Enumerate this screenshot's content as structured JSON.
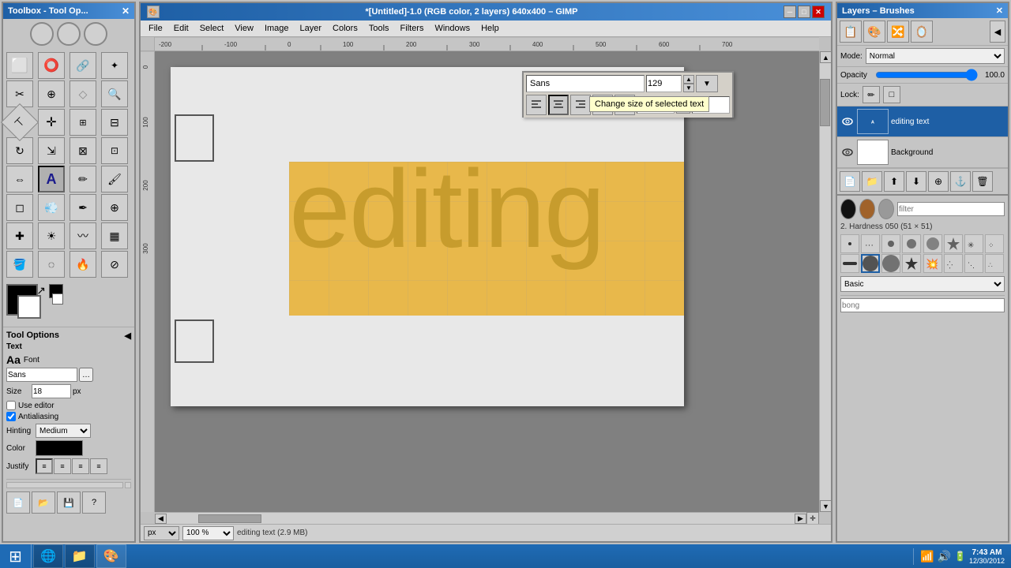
{
  "toolbox": {
    "title": "Toolbox - Tool Op...",
    "tools": [
      {
        "name": "rectangle-select",
        "icon": "□",
        "active": false
      },
      {
        "name": "ellipse-select",
        "icon": "○",
        "active": false
      },
      {
        "name": "free-select",
        "icon": "⌖",
        "active": false
      },
      {
        "name": "fuzzy-select",
        "icon": "✦",
        "active": false
      },
      {
        "name": "crop",
        "icon": "⊕",
        "active": false
      },
      {
        "name": "transform",
        "icon": "↔",
        "active": false
      },
      {
        "name": "flip",
        "icon": "⇔",
        "active": false
      },
      {
        "name": "text",
        "icon": "A",
        "active": true
      },
      {
        "name": "color-picker",
        "icon": "◈",
        "active": false
      },
      {
        "name": "magnify",
        "icon": "🔍",
        "active": false
      },
      {
        "name": "measure",
        "icon": "⊢",
        "active": false
      },
      {
        "name": "move",
        "icon": "✛",
        "active": false
      },
      {
        "name": "pencil",
        "icon": "✏",
        "active": false
      },
      {
        "name": "paint",
        "icon": "▲",
        "active": false
      },
      {
        "name": "eraser",
        "icon": "◻",
        "active": false
      },
      {
        "name": "airbrush",
        "icon": "∿",
        "active": false
      },
      {
        "name": "clone",
        "icon": "⊕",
        "active": false
      },
      {
        "name": "heal",
        "icon": "✚",
        "active": false
      },
      {
        "name": "perspective",
        "icon": "⌖",
        "active": false
      },
      {
        "name": "blend",
        "icon": "▦",
        "active": false
      },
      {
        "name": "bucket",
        "icon": "⬡",
        "active": false
      },
      {
        "name": "ink",
        "icon": "◈",
        "active": false
      },
      {
        "name": "dodge-burn",
        "icon": "☻",
        "active": false
      },
      {
        "name": "smudge",
        "icon": "⌀",
        "active": false
      }
    ],
    "options": {
      "title": "Tool Options",
      "text_label": "Text",
      "font_label": "Font",
      "font_value": "Sans",
      "size_label": "Size",
      "size_value": "18",
      "size_unit": "px",
      "use_editor_label": "Use editor",
      "antialiasing_label": "Antialiasing",
      "hinting_label": "Hinting",
      "hinting_value": "Medium",
      "color_label": "Color",
      "justify_label": "Justify"
    }
  },
  "gimp_window": {
    "title": "*[Untitled]-1.0 (RGB color, 2 layers) 640x400 – GIMP",
    "menus": [
      "File",
      "Edit",
      "Select",
      "View",
      "Image",
      "Layer",
      "Colors",
      "Tools",
      "Filters",
      "Windows",
      "Help"
    ],
    "canvas": {
      "text": "editing",
      "font": "Sans",
      "font_size": "129",
      "x_val": "0.0",
      "y_val": "0.0"
    },
    "tooltip": "Change size of selected text",
    "status": {
      "unit": "px",
      "zoom": "100 %",
      "layer": "editing text (2.9 MB)"
    }
  },
  "layers_panel": {
    "title": "Layers – Brushes",
    "mode_label": "Mode:",
    "mode_value": "Normal",
    "opacity_label": "Opacity",
    "opacity_value": "100.0",
    "lock_label": "Lock:",
    "layers": [
      {
        "name": "editing text",
        "visible": true,
        "active": true
      },
      {
        "name": "Background",
        "visible": true,
        "active": false
      }
    ],
    "brushes": {
      "filter_placeholder": "filter",
      "info": "2. Hardness 050 (51 × 51)",
      "category": "Basic",
      "swatches": [
        "black-circle",
        "brown-circle",
        "gray-circle"
      ],
      "items": [
        {
          "name": "dot-small",
          "shape": "dot",
          "size": 8
        },
        {
          "name": "brush-scattered",
          "shape": "scattered",
          "size": 10
        },
        {
          "name": "brush-fuzzy-sm",
          "shape": "fuzzy-sm",
          "size": 14
        },
        {
          "name": "brush-fuzzy-md",
          "shape": "fuzzy-md",
          "size": 20
        },
        {
          "name": "brush-fuzzy-lg",
          "shape": "fuzzy-lg",
          "size": 28
        },
        {
          "name": "brush-star",
          "shape": "star",
          "size": 24
        },
        {
          "name": "brush-splat",
          "shape": "splat",
          "size": 16
        },
        {
          "name": "brush-scattered2",
          "shape": "scattered2",
          "size": 12
        },
        {
          "name": "brush-line",
          "shape": "line",
          "size": 10
        },
        {
          "name": "brush-selected",
          "shape": "circle-lg",
          "size": 34
        },
        {
          "name": "brush-lg-circle",
          "shape": "lg-circle",
          "size": 40
        },
        {
          "name": "brush-star2",
          "shape": "star2",
          "size": 28
        },
        {
          "name": "brush-splatter",
          "shape": "splatter",
          "size": 18
        },
        {
          "name": "brush-scattered3",
          "shape": "scattered3",
          "size": 20
        },
        {
          "name": "brush-line2",
          "shape": "line2",
          "size": 12
        },
        {
          "name": "brush-small2",
          "shape": "small2",
          "size": 10
        }
      ]
    }
  },
  "taskbar": {
    "items": [
      {
        "name": "ie",
        "icon": "🌐",
        "label": ""
      },
      {
        "name": "explorer",
        "icon": "📁",
        "label": ""
      },
      {
        "name": "gimp-tb",
        "icon": "🎨",
        "label": ""
      }
    ],
    "tray": {
      "time": "7:43 AM",
      "date": "12/30/2012"
    }
  }
}
